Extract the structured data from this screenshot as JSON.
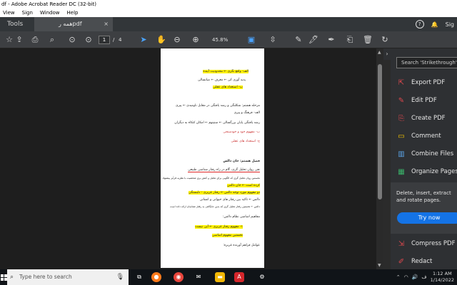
{
  "window": {
    "title": "df - Adobe Acrobat Reader DC (32-bit)"
  },
  "menu": [
    "View",
    "Sign",
    "Window",
    "Help"
  ],
  "tabs": {
    "tools": "Tools",
    "document": "همه رpdf",
    "close": "×"
  },
  "tab_right": {
    "help": "?",
    "bell": "🔔",
    "user": "Sig"
  },
  "toolbar": {
    "page_current": "1",
    "page_sep": "/",
    "page_total": "4",
    "zoom": "45.8%"
  },
  "right_pane": {
    "search_placeholder": "Search 'Strikethrough'",
    "items": [
      {
        "label": "Export PDF",
        "color": "#e0484e",
        "icon": "export-pdf-icon"
      },
      {
        "label": "Edit PDF",
        "color": "#e0484e",
        "icon": "edit-pdf-icon"
      },
      {
        "label": "Create PDF",
        "color": "#e0484e",
        "icon": "create-pdf-icon"
      },
      {
        "label": "Comment",
        "color": "#f5c400",
        "icon": "comment-icon"
      },
      {
        "label": "Combine Files",
        "color": "#5ba4e6",
        "icon": "combine-files-icon"
      },
      {
        "label": "Organize Pages",
        "color": "#3ab36a",
        "icon": "organize-pages-icon"
      },
      {
        "label": "Compress PDF",
        "color": "#e0484e",
        "icon": "compress-pdf-icon"
      },
      {
        "label": "Redact",
        "color": "#e0484e",
        "icon": "redact-icon"
      }
    ],
    "promo_text": "Delete, insert, extract and rotate pages.",
    "try_now": "Try now"
  },
  "taskbar": {
    "search_placeholder": "Type here to search",
    "time": "1:12 AM",
    "date": "1/14/2022"
  },
  "document_lines": [
    "الف- واقع نگری ← محدودیت آینده",
    "پدید آوری کی ← معرف ← میانسالی",
    "ب- استعداد های عقلی",
    "مرحله هشتم: شکلتگی و رشد یافتگی در مقابل ناومیدی ← پیری",
    "الف- فرهنگ و پیری",
    "رشد یافتگی پایان بزرگسالی ← ستیتوم ← امکان کنکاه به دیگران",
    "ب- مفهوم خود و خودسنجی",
    "ج- استعداد های عقلی",
    "فصل هشتم: جان دالس",
    "نفی روان تحلیل گری، گام در راه رفتار شناسی طبیعی",
    "نخستین روان تحلیل گری که الگویی برای تحلیل و کنش یری شخصیت با نظریه فرآیز پیشنهاد",
    "کرده است ← جان دالس",
    "دو مفهوم مورد توجه دالس ← رفتار غریزی - دلبستگی",
    "دالس ← تاکید بین رفتار های حیوانی و انسانی",
    "دالس ← نخستین رفتار تحلیل گری که بدین جایگاهی به رفتار شناسان ارائه داده است",
    "مفاهیم اساسی نظام دالس:",
    "۱- مفهوم رفتار غریزی ← آیی نیست",
    "نخستین مفهوم اساسی",
    "عوامل فراهم آورنده غریزه:"
  ]
}
